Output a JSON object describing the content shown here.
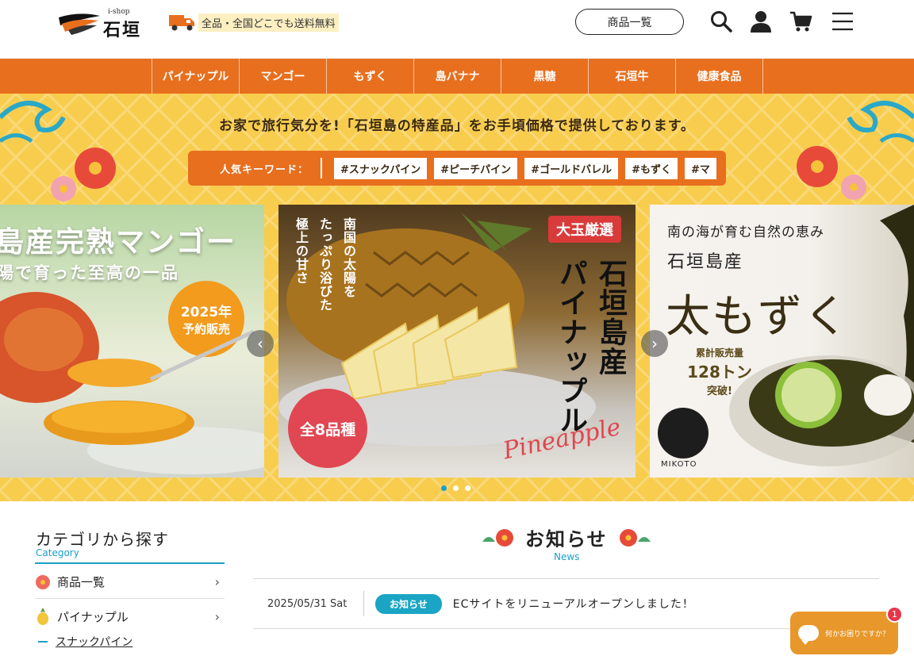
{
  "header": {
    "logo_small": "i-shop",
    "logo_big": "石垣",
    "shipping_text": "全品・全国どこでも送料無料",
    "products_button": "商品一覧",
    "icons": [
      "search-icon",
      "user-icon",
      "cart-icon",
      "menu-icon"
    ]
  },
  "nav": {
    "items": [
      {
        "label": "パイナップル"
      },
      {
        "label": "マンゴー"
      },
      {
        "label": "もずく"
      },
      {
        "label": "島バナナ"
      },
      {
        "label": "黒糖"
      },
      {
        "label": "石垣牛"
      },
      {
        "label": "健康食品"
      }
    ]
  },
  "hero": {
    "tagline": "お家で旅行気分を!「石垣島の特産品」をお手頃価格で提供しております。",
    "keyword_label": "人気キーワード：",
    "keywords": [
      "#スナックパイン",
      "#ピーチパイン",
      "#ゴールドバレル",
      "#もずく",
      "#マ"
    ],
    "slides": {
      "mango": {
        "title": "島産完熟マンゴー",
        "subtitle": "陽で育った至高の一品",
        "badge_line1": "2025年",
        "badge_line2": "予約販売"
      },
      "pineapple": {
        "tag": "大玉厳選",
        "col1": "石垣島産",
        "col2": "パイナップル",
        "copy1": "南国の太陽を",
        "copy2": "たっぷり浴びた",
        "copy3": "極上の甘さ",
        "count_badge": "全8品種",
        "script_word": "Pineapple"
      },
      "mozuku": {
        "line1": "南の海が育む自然の恵み",
        "line2": "石垣島産",
        "big": "太もずく",
        "award1": "累計販売量",
        "award2": "128トン",
        "award3": "突破!",
        "brand": "MIKOTO"
      }
    },
    "prev_arrow": "‹",
    "next_arrow": "›",
    "dots": 3,
    "active_dot": 0
  },
  "category": {
    "title": "カテゴリから探す",
    "subtitle": "Category",
    "items": [
      {
        "label": "商品一覧",
        "icon": "hibiscus-icon"
      },
      {
        "label": "パイナップル",
        "icon": "pineapple-icon"
      }
    ],
    "sub_item": "スナックパイン"
  },
  "news": {
    "title": "お知らせ",
    "subtitle": "News",
    "rows": [
      {
        "date": "2025/05/31  Sat",
        "badge": "お知らせ",
        "text": "ECサイトをリニューアルオープンしました！"
      }
    ]
  },
  "chat": {
    "text": "何かお困りですか？",
    "badge": "1"
  },
  "colors": {
    "brand_orange": "#e86f1e",
    "hero_yellow": "#f8cd4e",
    "accent_blue": "#1a9fc7",
    "chat_orange": "#e8972a"
  }
}
